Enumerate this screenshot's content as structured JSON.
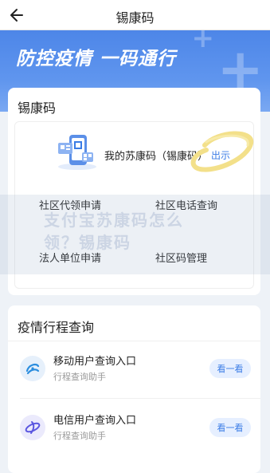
{
  "header": {
    "title": "锡康码",
    "back_icon": "arrow-left-icon"
  },
  "banner": {
    "slogan": "防控疫情 一码通行"
  },
  "kangma_card": {
    "title": "锡康码",
    "code_label": "我的苏康码（锡康码）",
    "show_link": "出示",
    "grid": {
      "community_apply": "社区代领申请",
      "community_phone": "社区电话查询",
      "legal_person": "法人单位申请",
      "unit_code": "社区码管理"
    }
  },
  "watermark": {
    "line1": "支付宝苏康码怎么",
    "line2": "领？锡康码"
  },
  "trip_card": {
    "title": "疫情行程查询",
    "items": [
      {
        "name": "移动用户查询入口",
        "sub": "行程查询助手",
        "button": "看一看",
        "icon": "china-mobile-icon",
        "color": "#2b8dde"
      },
      {
        "name": "电信用户查询入口",
        "sub": "行程查询助手",
        "button": "看一看",
        "icon": "china-telecom-icon",
        "color": "#5b57e0"
      }
    ]
  },
  "colors": {
    "accent": "#3b7ce6",
    "banner": "#4d86e8",
    "background": "#eef2f7"
  }
}
